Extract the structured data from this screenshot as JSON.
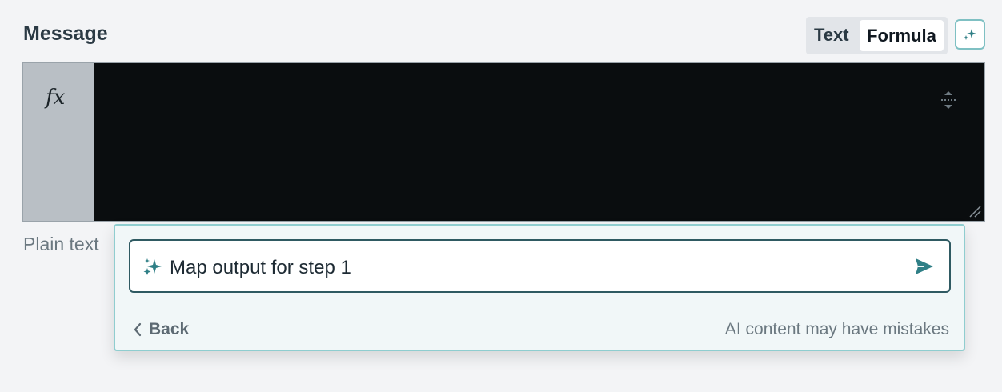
{
  "field": {
    "label": "Message",
    "helper_text": "Plain text"
  },
  "mode_toggle": {
    "text_label": "Text",
    "formula_label": "Formula",
    "selected": "Formula"
  },
  "editor": {
    "gutter_icon": "fx-icon",
    "gutter_symbol": "fx",
    "value": ""
  },
  "ai_prompt": {
    "value": "Map output for step 1",
    "back_label": "Back",
    "disclaimer": "AI content may have mistakes"
  },
  "colors": {
    "accent": "#2f7f86",
    "editor_bg": "#0a0d0f",
    "popover_border": "#8fcdcf"
  }
}
